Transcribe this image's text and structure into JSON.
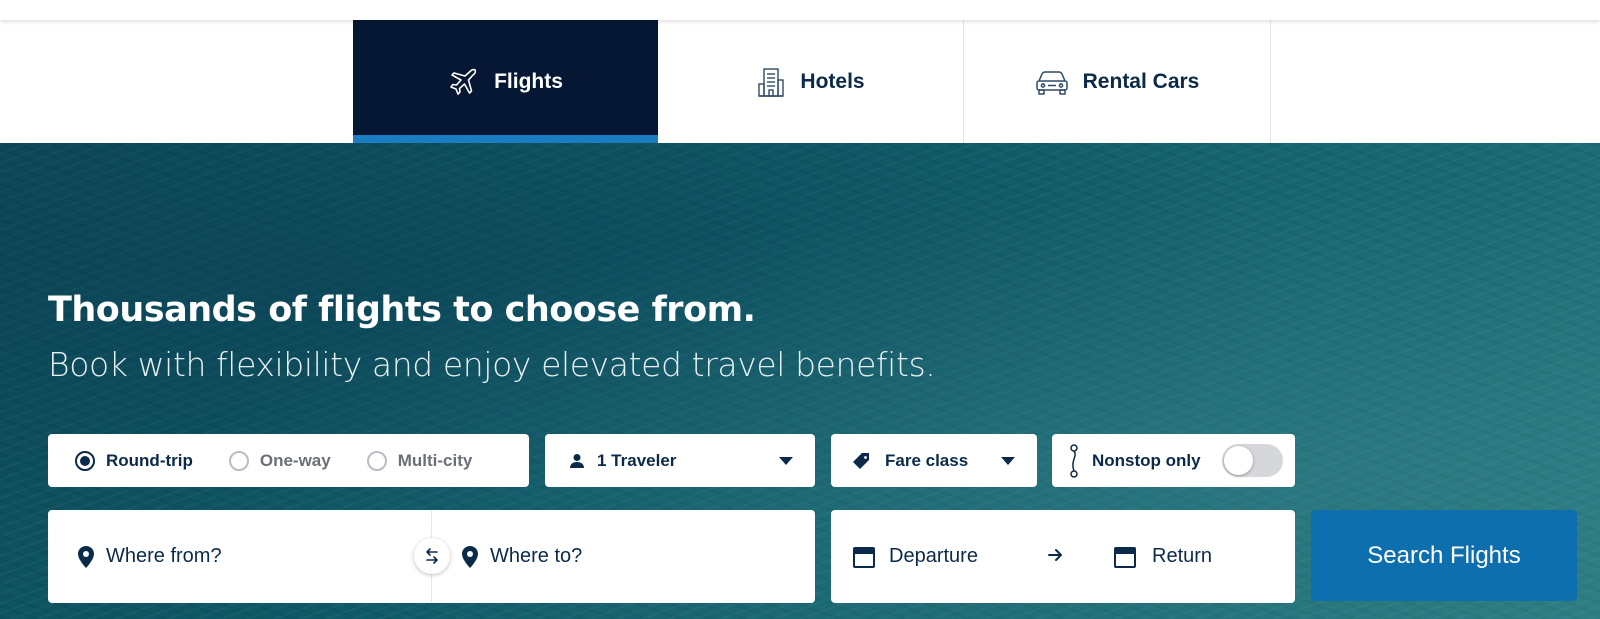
{
  "tabs": [
    {
      "label": "Flights",
      "icon": "airplane-icon",
      "active": true
    },
    {
      "label": "Hotels",
      "icon": "hotel-building-icon",
      "active": false
    },
    {
      "label": "Rental Cars",
      "icon": "car-icon",
      "active": false
    }
  ],
  "hero": {
    "headline_pre": "Thousands of ",
    "headline_bold": "flights",
    "headline_post": " to choose from.",
    "subline": "Book with flexibility and enjoy elevated travel benefits."
  },
  "search": {
    "trip_types": [
      {
        "label": "Round-trip",
        "selected": true
      },
      {
        "label": "One-way",
        "selected": false
      },
      {
        "label": "Multi-city",
        "selected": false
      }
    ],
    "travelers": "1 Traveler",
    "fare_class": "Fare class",
    "nonstop_label": "Nonstop only",
    "nonstop_on": false,
    "from_placeholder": "Where from?",
    "to_placeholder": "Where to?",
    "departure_placeholder": "Departure",
    "return_placeholder": "Return",
    "submit_label": "Search Flights"
  },
  "colors": {
    "navy": "#061733",
    "accent_blue": "#1a7cc1",
    "button_blue": "#0e6faf",
    "text_navy": "#0b2a4a"
  }
}
